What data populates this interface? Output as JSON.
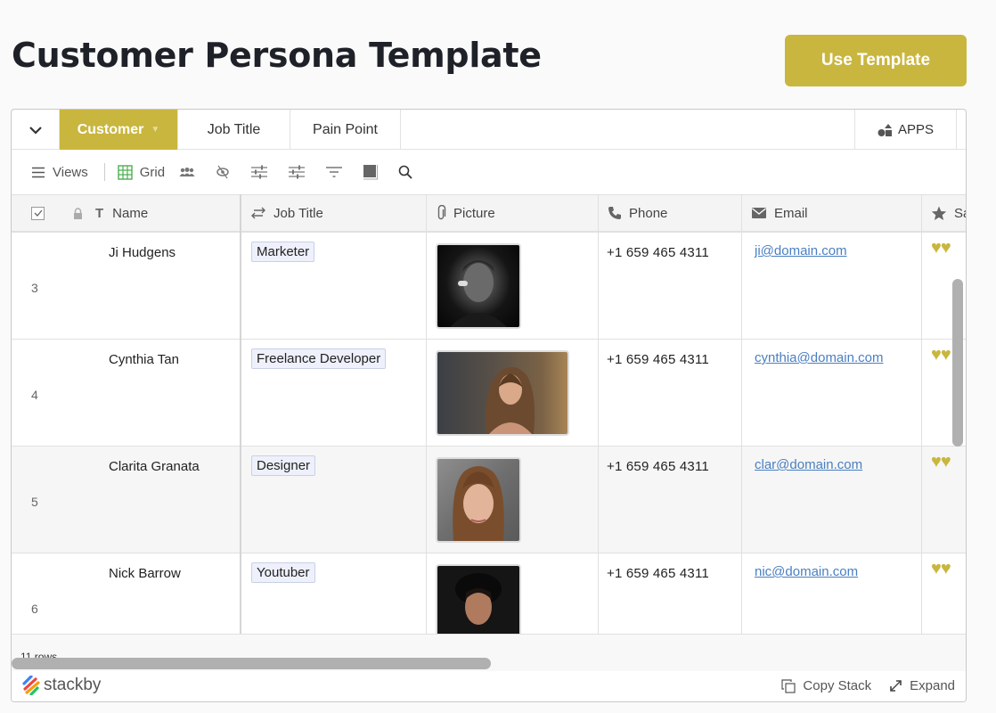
{
  "page": {
    "title": "Customer Persona Template",
    "use_template_label": "Use Template"
  },
  "tabs": {
    "items": [
      {
        "label": "Customer",
        "active": true
      },
      {
        "label": "Job Title",
        "active": false
      },
      {
        "label": "Pain Point",
        "active": false
      }
    ],
    "apps_label": "APPS"
  },
  "toolbar": {
    "views_label": "Views",
    "grid_label": "Grid",
    "icons": [
      "people-icon",
      "hide-fields-icon",
      "sliders-icon",
      "sliders-icon",
      "filter-icon",
      "row-color-icon",
      "search-icon"
    ]
  },
  "columns": [
    {
      "label": "Name",
      "icon": "text-type-icon"
    },
    {
      "label": "Job Title",
      "icon": "link-arrows-icon"
    },
    {
      "label": "Picture",
      "icon": "paperclip-icon"
    },
    {
      "label": "Phone",
      "icon": "phone-icon"
    },
    {
      "label": "Email",
      "icon": "envelope-icon"
    },
    {
      "label": "Sa",
      "icon": "star-icon"
    }
  ],
  "rows": [
    {
      "num": "3",
      "name": "Ji Hudgens",
      "job": "Marketer",
      "phone": "+1 659 465 4311",
      "email": "ji@domain.com",
      "rating_hearts": "♥♥"
    },
    {
      "num": "4",
      "name": "Cynthia Tan",
      "job": "Freelance Developer",
      "phone": "+1 659 465 4311",
      "email": "cynthia@domain.com",
      "rating_hearts": "♥♥"
    },
    {
      "num": "5",
      "name": "Clarita Granata",
      "job": "Designer",
      "phone": "+1 659 465 4311",
      "email": "clar@domain.com",
      "rating_hearts": "♥♥"
    },
    {
      "num": "6",
      "name": "Nick Barrow",
      "job": "Youtuber",
      "phone": "+1 659 465 4311",
      "email": "nic@domain.com",
      "rating_hearts": "♥♥"
    }
  ],
  "footer": {
    "row_count": "11 rows",
    "brand": "stackby",
    "copy_label": "Copy Stack",
    "expand_label": "Expand"
  },
  "colors": {
    "accent": "#c9b63f",
    "link": "#4a7fc1",
    "pill_bg": "#eef1fb"
  }
}
